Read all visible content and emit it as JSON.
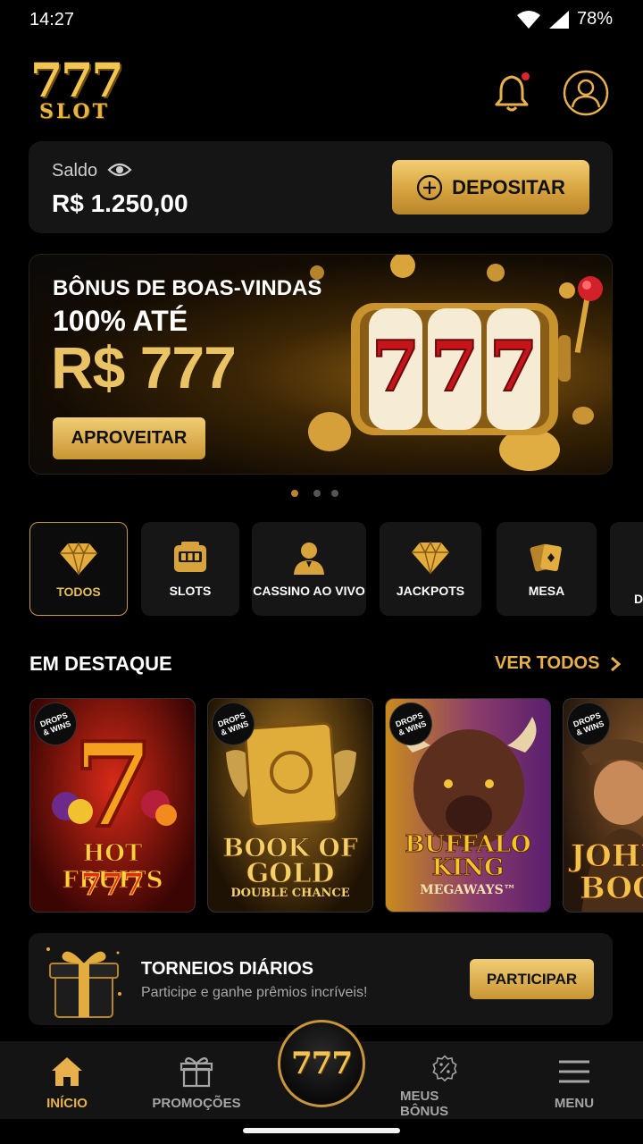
{
  "status_bar": {
    "time": "14:27",
    "battery": "78%"
  },
  "header": {
    "logo_top": "777",
    "logo_bottom": "SLOT"
  },
  "balance": {
    "label": "Saldo",
    "value": "R$ 1.250,00",
    "deposit_label": "DEPOSITAR"
  },
  "banner": {
    "subtitle": "BÔNUS DE BOAS-VINDAS",
    "middle": "100% ATÉ",
    "amount": "R$ 777",
    "button": "APROVEITAR",
    "reels": [
      "7",
      "7",
      "7"
    ],
    "pages": 3,
    "active_page": 1
  },
  "categories": [
    {
      "label": "TODOS",
      "icon": "diamond-icon",
      "active": true
    },
    {
      "label": "SLOTS",
      "icon": "slot-machine-icon",
      "active": false
    },
    {
      "label": "CASSINO AO VIVO",
      "icon": "dealer-icon",
      "active": false
    },
    {
      "label": "JACKPOTS",
      "icon": "diamond-icon",
      "active": false
    },
    {
      "label": "MESA",
      "icon": "cards-icon",
      "active": false
    },
    {
      "label": "D",
      "icon": "",
      "active": false
    }
  ],
  "featured": {
    "title": "EM DESTAQUE",
    "see_all": "VER TODOS",
    "badge_lines": [
      "DROPS",
      "& WINS"
    ],
    "games": [
      {
        "title_lines": [
          "HOT FRUITS",
          "777"
        ],
        "colors": [
          "#b3140f",
          "#3a0503"
        ]
      },
      {
        "title_lines": [
          "BOOK OF",
          "GOLD",
          "DOUBLE CHANCE"
        ],
        "colors": [
          "#6b4410",
          "#1e1204"
        ]
      },
      {
        "title_lines": [
          "BUFFALO",
          "KING",
          "MEGAWAYS™"
        ],
        "colors": [
          "#7a3d8c",
          "#2a1230"
        ]
      },
      {
        "title_lines": [
          "JOHN",
          "BOO"
        ],
        "colors": [
          "#6d4322",
          "#24160b"
        ]
      }
    ]
  },
  "tournament": {
    "title": "TORNEIOS DIÁRIOS",
    "subtitle": "Participe e ganhe prêmios incríveis!",
    "button": "PARTICIPAR"
  },
  "bottom_nav": {
    "items": [
      {
        "label": "INÍCIO",
        "icon": "home-icon",
        "active": true
      },
      {
        "label": "PROMOÇÕES",
        "icon": "gift-icon",
        "active": false
      },
      {
        "label": "MEUS BÔNUS",
        "icon": "percent-badge-icon",
        "active": false
      },
      {
        "label": "MENU",
        "icon": "hamburger-icon",
        "active": false
      }
    ],
    "center_label": "777"
  },
  "colors": {
    "gold": "#e7b04c",
    "background": "#000000",
    "card": "#151515"
  }
}
